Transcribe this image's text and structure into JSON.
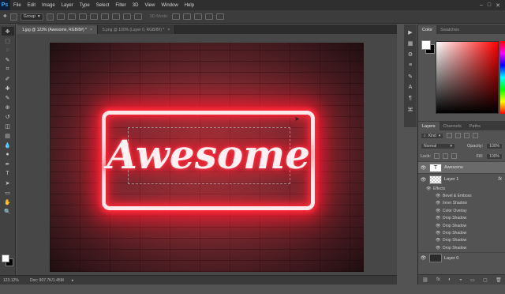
{
  "menubar": {
    "logo": "Ps",
    "items": [
      "File",
      "Edit",
      "Image",
      "Layer",
      "Type",
      "Select",
      "Filter",
      "3D",
      "View",
      "Window",
      "Help"
    ],
    "window_controls": [
      "–",
      "□",
      "✕"
    ]
  },
  "options": {
    "group_select": "Group",
    "mode_3d": "3D Mode:"
  },
  "tabs": [
    {
      "label": "1.jpg @ 123% (Awesome, RGB/8#) *",
      "close": "×"
    },
    {
      "label": "5.png @ 100% (Layer 0, RGB/8#) *",
      "close": "×"
    }
  ],
  "tools": [
    "move-icon",
    "marquee-icon",
    "lasso-icon",
    "quick-select-icon",
    "crop-icon",
    "eyedropper-icon",
    "healing-icon",
    "brush-icon",
    "stamp-icon",
    "history-brush-icon",
    "eraser-icon",
    "gradient-icon",
    "blur-icon",
    "dodge-icon",
    "pen-icon",
    "type-icon",
    "path-select-icon",
    "rectangle-icon",
    "hand-icon",
    "zoom-icon"
  ],
  "tool_glyphs": [
    "✥",
    "⬚",
    "◌",
    "✎",
    "⌗",
    "✐",
    "✚",
    "✎",
    "⊕",
    "↺",
    "◫",
    "▤",
    "💧",
    "●",
    "✒",
    "T",
    "➤",
    "▭",
    "✋",
    "🔍"
  ],
  "canvas": {
    "neon_text": "Awesome",
    "colors": {
      "neon": "#ff2a3a",
      "neon_core": "#fff0f1",
      "brick": "#5a2e33"
    }
  },
  "status": {
    "zoom": "123.12%",
    "doc": "Doc: 907.7K/1.45M"
  },
  "side_icons": [
    "▶",
    "▦",
    "⚙",
    "≡",
    "✎",
    "A",
    "¶",
    "⌘"
  ],
  "color_panel": {
    "tabs": [
      "Color",
      "Swatches"
    ]
  },
  "layers_panel": {
    "tabs": [
      "Layers",
      "Channels",
      "Paths"
    ],
    "filter": "Kind",
    "blend_mode": "Normal",
    "opacity_label": "Opacity:",
    "opacity_value": "100%",
    "lock_label": "Lock:",
    "fill_label": "Fill:",
    "fill_value": "100%",
    "layers": [
      {
        "name": "Awesome",
        "thumb": "T"
      },
      {
        "name": "Layer 1",
        "fx": "fx"
      },
      {
        "name": "Layer 0"
      }
    ],
    "effects_title": "Effects",
    "effects": [
      "Bevel & Emboss",
      "Inner Shadow",
      "Color Overlay",
      "Drop Shadow",
      "Drop Shadow",
      "Drop Shadow",
      "Drop Shadow",
      "Drop Shadow"
    ],
    "footer_icons": [
      "⛓",
      "fx",
      "◐",
      "◒",
      "▭",
      "▢",
      "🗑"
    ]
  }
}
